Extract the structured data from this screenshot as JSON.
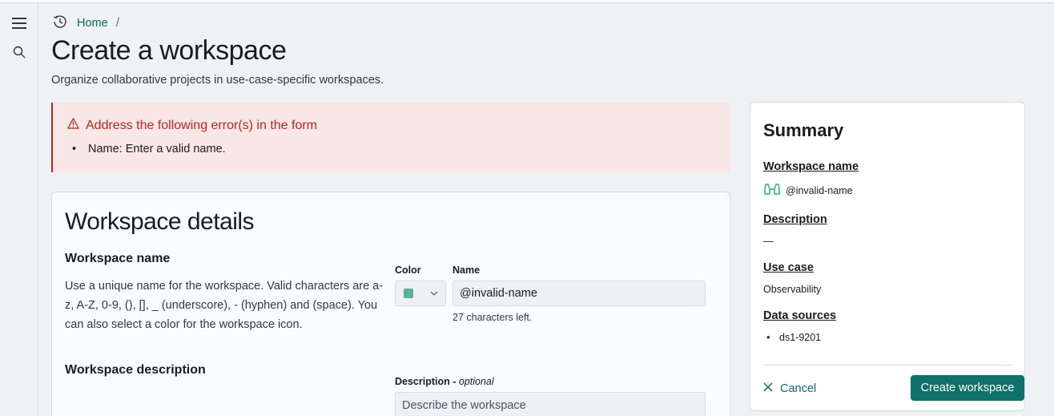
{
  "nav": {
    "menu_icon": "hamburger-menu-icon",
    "search_icon": "search-icon"
  },
  "breadcrumb": {
    "history_icon": "history-icon",
    "home": "Home",
    "separator": "/"
  },
  "page": {
    "title": "Create a workspace",
    "subtitle": "Organize collaborative projects in use-case-specific workspaces."
  },
  "error": {
    "title": "Address the following error(s) in the form",
    "items": [
      "Name: Enter a valid name."
    ],
    "color": "#bd271e"
  },
  "details": {
    "title": "Workspace details",
    "name_section": {
      "heading": "Workspace name",
      "help": "Use a unique name for the workspace. Valid characters are a-z, A-Z, 0-9, (), [], _ (underscore), - (hyphen) and (space). You can also select a color for the workspace icon.",
      "color_label": "Color",
      "color_value": "#54b399",
      "name_label": "Name",
      "name_value": "@invalid-name",
      "name_help": "27 characters left."
    },
    "description_section": {
      "heading": "Workspace description",
      "label": "Description",
      "label_optional": "optional",
      "placeholder": "Describe the workspace"
    }
  },
  "summary": {
    "title": "Summary",
    "name_heading": "Workspace name",
    "name_value": "@invalid-name",
    "name_icon": "binoculars-icon",
    "description_heading": "Description",
    "description_value": "—",
    "use_case_heading": "Use case",
    "use_case_value": "Observability",
    "data_sources_heading": "Data sources",
    "data_sources": [
      "ds1-9201"
    ],
    "cancel_label": "Cancel",
    "create_label": "Create workspace"
  },
  "colors": {
    "accent": "#0b6b63",
    "primary_button": "#12706a"
  }
}
